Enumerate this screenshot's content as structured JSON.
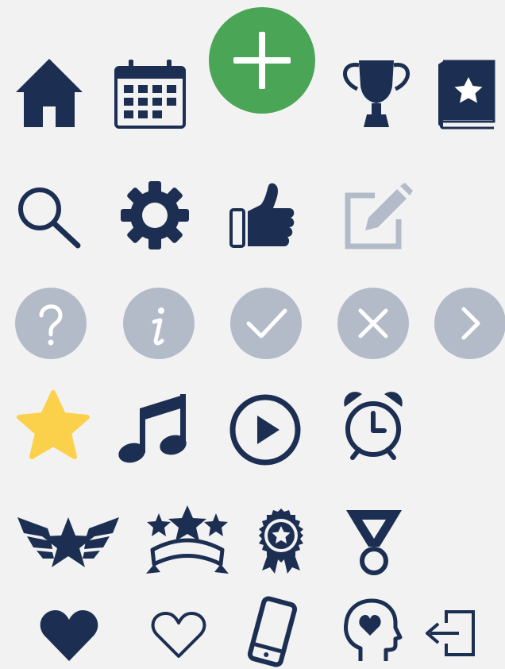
{
  "colors": {
    "navy": "#1c2f52",
    "gray": "#b3bac8",
    "green": "#4aa556",
    "yellow": "#fbd14b",
    "white": "#ffffff",
    "background": "#f2f2f2"
  },
  "rows": [
    [
      "home-icon",
      "calendar-icon",
      "add-icon",
      "trophy-icon",
      "favorites-book-icon"
    ],
    [
      "search-icon",
      "gear-icon",
      "thumbs-up-icon",
      "edit-icon"
    ],
    [
      "help-icon",
      "info-icon",
      "check-icon",
      "close-icon",
      "chevron-right-icon"
    ],
    [
      "star-icon",
      "music-note-icon",
      "play-icon",
      "alarm-clock-icon"
    ],
    [
      "winged-star-icon",
      "stars-banner-icon",
      "award-rosette-icon",
      "medal-icon"
    ],
    [
      "heart-filled-icon",
      "heart-outline-icon",
      "phone-icon",
      "mind-heart-icon",
      "logout-icon"
    ]
  ]
}
